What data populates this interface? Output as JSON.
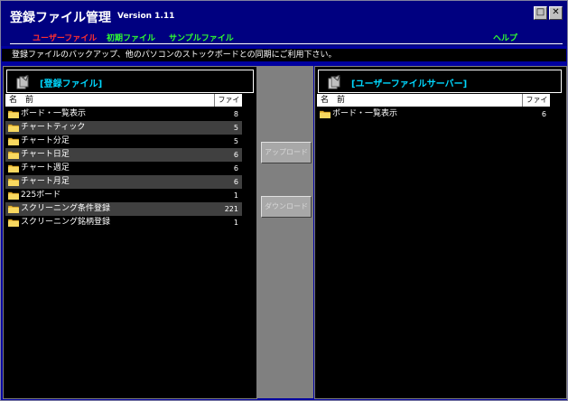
{
  "window": {
    "title": "登録ファイル管理",
    "version": "Version 1.11",
    "restore_glyph": "□",
    "close_glyph": "✕"
  },
  "menu": {
    "items": [
      {
        "label": "ユーザーファイル",
        "color": "#ff3030"
      },
      {
        "label": "初期ファイル",
        "color": "#30ff30"
      },
      {
        "label": "サンプルファイル",
        "color": "#30ff30"
      }
    ],
    "help": {
      "label": "ヘルプ",
      "color": "#30ff30"
    }
  },
  "message": "登録ファイルのバックアップ、他のパソコンのストックボードとの同期にご利用下さい。",
  "left_pane": {
    "title": "[登録ファイル]",
    "col_name": "名　前",
    "col_count": "ファイル数",
    "rows": [
      {
        "name": "ボード・一覧表示",
        "count": "8"
      },
      {
        "name": "チャートティック",
        "count": "5"
      },
      {
        "name": "チャート分足",
        "count": "5"
      },
      {
        "name": "チャート日足",
        "count": "6"
      },
      {
        "name": "チャート週足",
        "count": "6"
      },
      {
        "name": "チャート月足",
        "count": "6"
      },
      {
        "name": "225ボード",
        "count": "1"
      },
      {
        "name": "スクリーニング条件登録",
        "count": "221"
      },
      {
        "name": "スクリーニング銘柄登録",
        "count": "1"
      }
    ]
  },
  "right_pane": {
    "title": "[ユーザーファイルサーバー]",
    "col_name": "名　前",
    "col_count": "ファイル数",
    "rows": [
      {
        "name": "ボード・一覧表示",
        "count": "6"
      }
    ]
  },
  "buttons": {
    "upload": "アップロード",
    "download": "ダウンロード"
  },
  "colors": {
    "accent": "#00d8ff",
    "folder": "#f0c040"
  }
}
